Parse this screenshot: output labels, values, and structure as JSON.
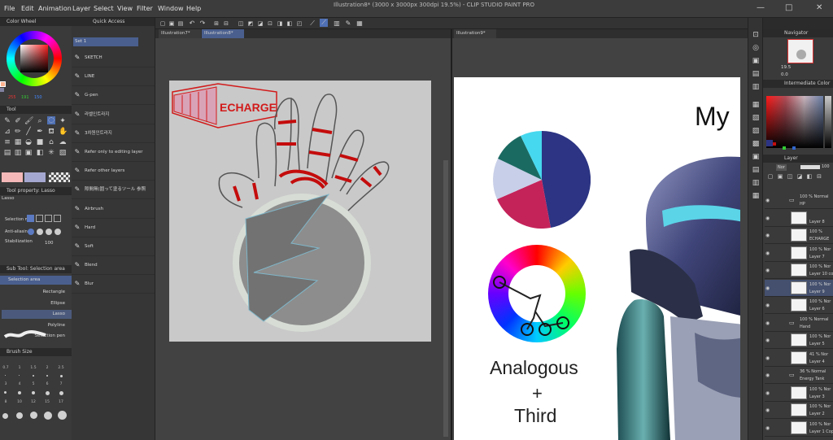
{
  "window": {
    "title": "Illustration8* (3000 x 3000px 300dpi 19.5%) - CLIP STUDIO PAINT PRO",
    "minimize": "—",
    "maximize": "□",
    "close": "✕"
  },
  "menu": [
    "File",
    "Edit",
    "Animation",
    "Layer",
    "Select",
    "View",
    "Filter",
    "Window",
    "Help"
  ],
  "left": {
    "color_wheel": {
      "title": "Color Wheel",
      "r": "255",
      "g": "191",
      "b": "150"
    },
    "tool": {
      "title": "Tool"
    },
    "tool_property": {
      "title": "Tool property: Lasso",
      "tool_name": "Lasso",
      "selection_mode": "Selection m",
      "anti_aliasing": "Anti-aliasing",
      "stabilization": "Stabilization",
      "stabilization_value": "100"
    },
    "sub_tool": {
      "title": "Sub Tool: Selection area",
      "group": "Selection area",
      "items": [
        "Rectangle",
        "Ellipse",
        "Lasso",
        "Polyline",
        "Selection pen"
      ]
    },
    "brush_size": {
      "title": "Brush Size",
      "sizes": [
        "0.7",
        "1",
        "1.5",
        "2",
        "2.5",
        "3",
        "4",
        "5",
        "6",
        "7",
        "8",
        "10",
        "12",
        "15",
        "17"
      ]
    }
  },
  "quick_access": {
    "title": "Quick Access",
    "set": "Set 1",
    "items": [
      {
        "label": "SKETCH",
        "icon": "pencil-icon"
      },
      {
        "label": "LINE",
        "icon": "pen-icon"
      },
      {
        "label": "G-pen",
        "icon": "pen-icon"
      },
      {
        "label": "라벨인트라지",
        "icon": "doc-icon"
      },
      {
        "label": "3차원인트라지",
        "icon": "doc-icon"
      },
      {
        "label": "Refer only to editing layer",
        "icon": "fill-icon"
      },
      {
        "label": "Refer other layers",
        "icon": "fill-icon"
      },
      {
        "label": "隙間無(囲って塗るツール 参照",
        "icon": "fill-icon"
      },
      {
        "label": "Airbrush",
        "icon": "airbrush-icon"
      },
      {
        "label": "Hard",
        "icon": "brush-icon"
      },
      {
        "label": "Soft",
        "icon": "brush-icon"
      },
      {
        "label": "Blend",
        "icon": "blend-icon"
      },
      {
        "label": "Blur",
        "icon": "blur-icon"
      }
    ]
  },
  "canvas_tabs": {
    "left": [
      "Illustration7*",
      "Illustration8*"
    ],
    "right": [
      "Illustration9*"
    ]
  },
  "canvas": {
    "logo_text": "ECHARGE"
  },
  "reference": {
    "title_partial": "My",
    "harmony_label_1": "Analogous",
    "harmony_label_2": "+",
    "harmony_label_3": "Third"
  },
  "navigator": {
    "title": "Navigator",
    "zoom": "19.5",
    "angle": "0.0"
  },
  "intermediate_color": {
    "title": "Intermediate Color"
  },
  "layer_panel": {
    "title": "Layer",
    "blend": "Nor",
    "opacity": "100",
    "rows": [
      {
        "type": "folder",
        "lab1": "100 % Normal",
        "lab2": "HP"
      },
      {
        "type": "layer",
        "lab1": "",
        "lab2": "Layer 8"
      },
      {
        "type": "layer",
        "lab1": "100 %",
        "lab2": "ECHARGE"
      },
      {
        "type": "layer",
        "lab1": "100 % Nor",
        "lab2": "Layer 7"
      },
      {
        "type": "layer",
        "lab1": "100 % Nor",
        "lab2": "Layer 10 co"
      },
      {
        "type": "layer",
        "lab1": "100 % Nor",
        "lab2": "Layer 9"
      },
      {
        "type": "layer",
        "lab1": "100 % Nor",
        "lab2": "Layer 6"
      },
      {
        "type": "folder",
        "lab1": "100 % Normal",
        "lab2": "Hand"
      },
      {
        "type": "layer",
        "lab1": "100 % Nor",
        "lab2": "Layer 5"
      },
      {
        "type": "layer",
        "lab1": "41 % Nor",
        "lab2": "Layer 4"
      },
      {
        "type": "folder",
        "lab1": "36 % Normal",
        "lab2": "Energy Tank"
      },
      {
        "type": "layer",
        "lab1": "100 % Nor",
        "lab2": "Layer 3"
      },
      {
        "type": "layer",
        "lab1": "100 % Nor",
        "lab2": "Layer 2"
      },
      {
        "type": "layer",
        "lab1": "100 % Nor",
        "lab2": "Layer 1 Copy"
      }
    ]
  },
  "colors": {
    "accent": "#3f88e0",
    "canvas_bg": "#c9c9c9",
    "red": "#c40c0c",
    "pie_navy": "#2c3483",
    "pie_pink": "#c4235a",
    "pie_lavender": "#c8cfe8",
    "pie_teal": "#1b6a62",
    "pie_cyan": "#46d8ee"
  }
}
